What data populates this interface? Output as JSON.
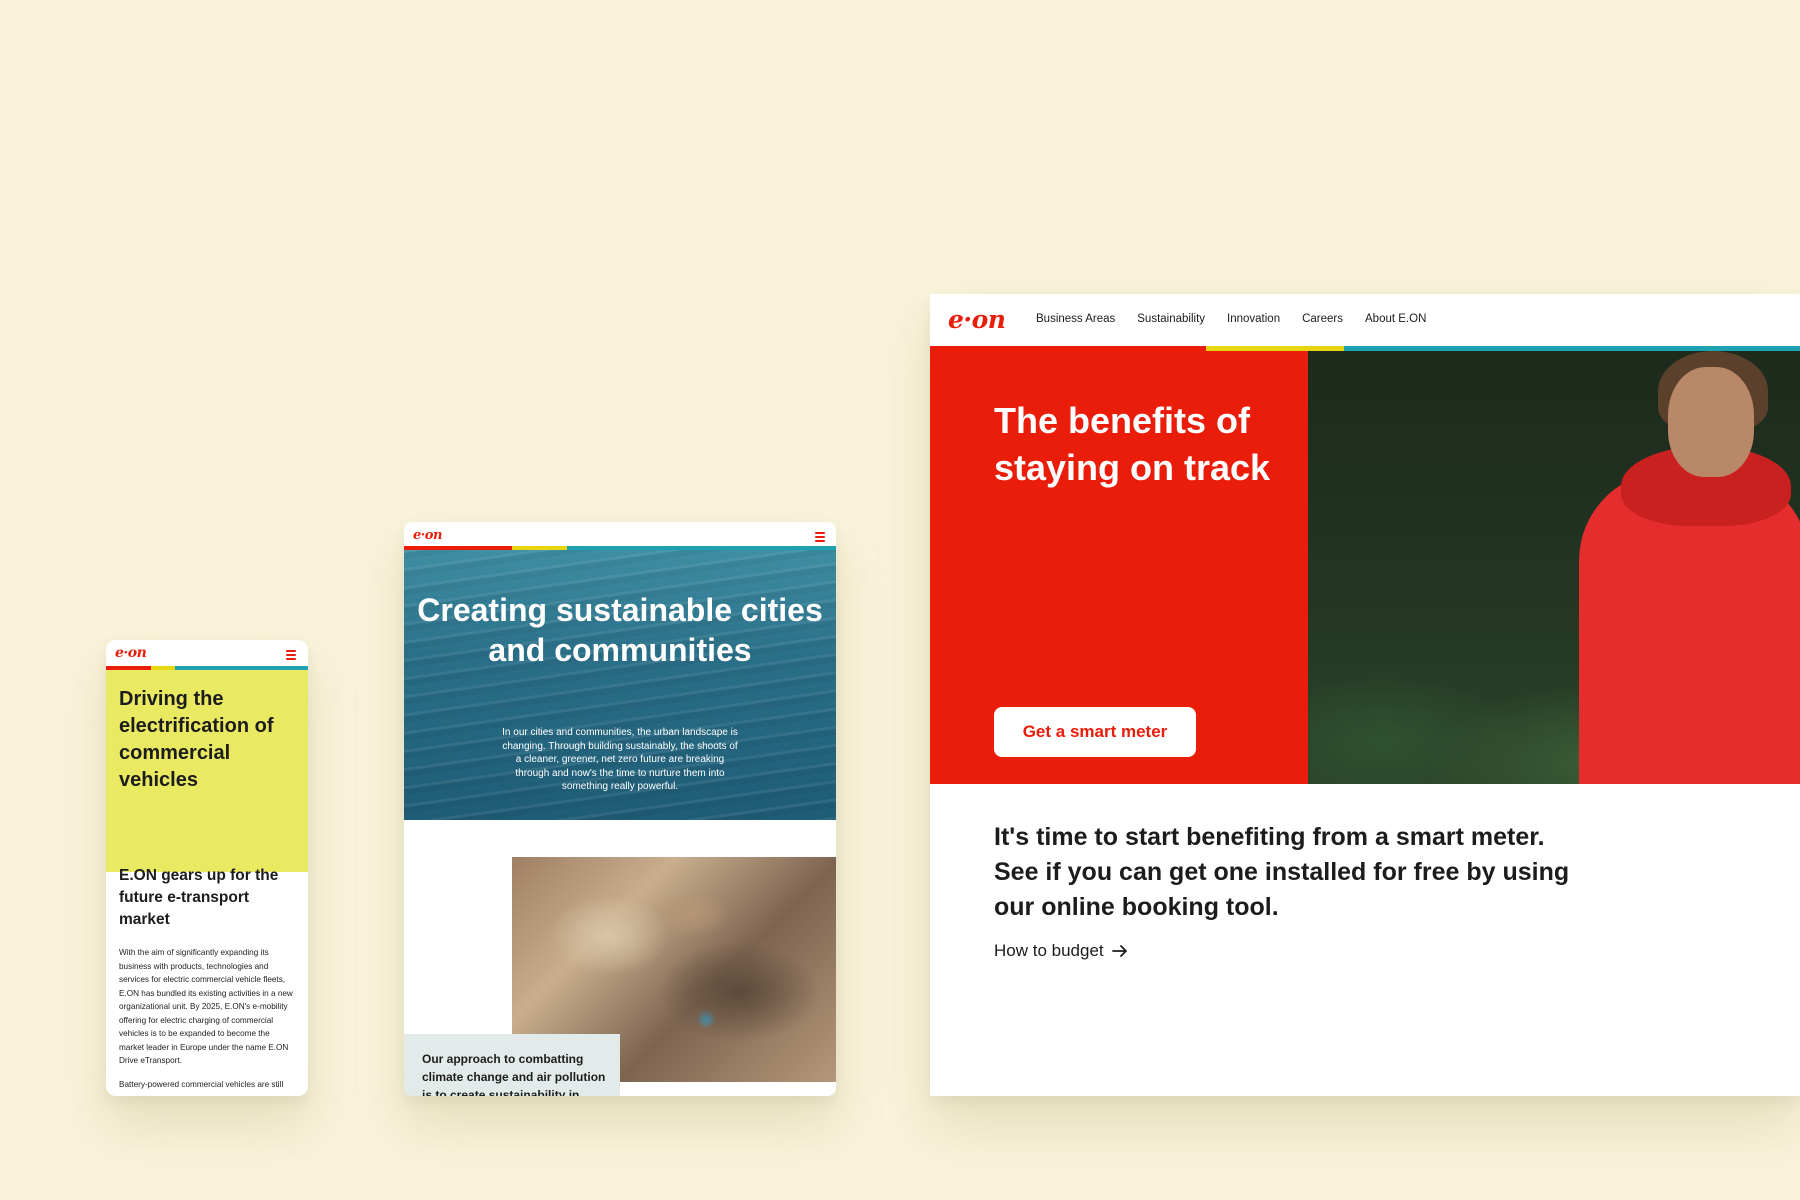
{
  "colors": {
    "background": "#f8f3da",
    "brand_red": "#ea1c0a",
    "yellow": "#eaea62",
    "stripe_yellow": "#e6d510",
    "stripe_teal": "#1ea2b1",
    "teal_water": "#2a6f88",
    "quote_bg": "#e3ebea"
  },
  "brand": {
    "logo_text": "e·on"
  },
  "mobile": {
    "hero_title": "Driving the electrification of commercial vehicles",
    "article_title": "E.ON gears up for the future e-transport market",
    "paragraph": "With the aim of significantly expanding its business with products, technologies and services for electric commercial vehicle fleets, E.ON has bundled its existing activities in a new organizational unit. By 2025, E.ON's e-mobility offering for electric charging of commercial vehicles is to be expanded to become the market leader in Europe under the name E.ON Drive eTransport.",
    "paragraph2": "Battery-powered commercial vehicles are still",
    "menu_icon": "hamburger-icon"
  },
  "tablet": {
    "hero_title": "Creating sustainable cities and communities",
    "hero_text": "In our cities and communities, the urban landscape is changing. Through building sustainably, the shoots of a cleaner, greener, net zero future are breaking through and now's the time to nurture them into something really powerful.",
    "quote": "Our approach to combatting climate change and air pollution is to create sustainability in",
    "menu_icon": "hamburger-icon"
  },
  "desktop": {
    "nav": [
      "Business Areas",
      "Sustainability",
      "Innovation",
      "Careers",
      "About E.ON"
    ],
    "hero_title": "The benefits of staying on track",
    "cta_label": "Get a smart meter",
    "lead": "It's time to start benefiting from a smart meter. See if you can get one installed for free by using our online booking tool.",
    "link_label": "How to budget",
    "link_icon": "arrow-right-icon"
  }
}
